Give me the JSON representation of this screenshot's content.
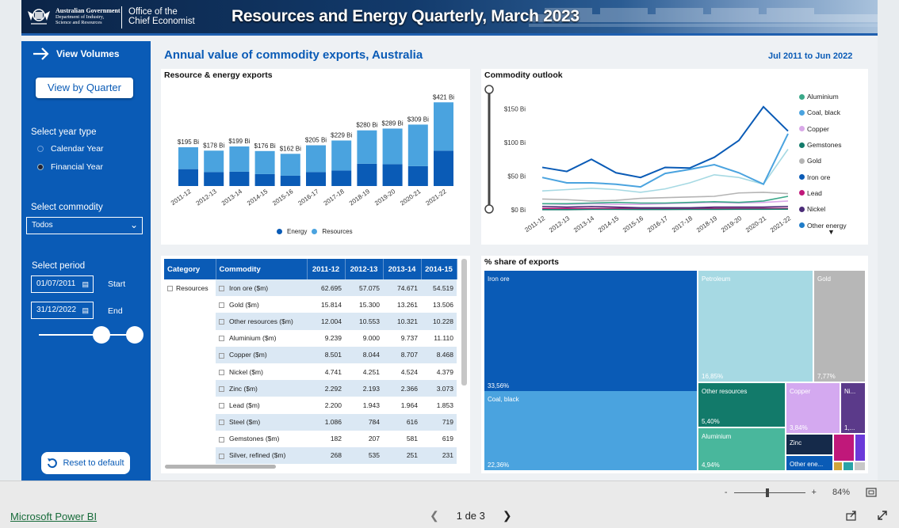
{
  "banner": {
    "gov_line1": "Australian Government",
    "gov_line2": "Department of Industry,",
    "gov_line3": "Science and Resources",
    "oce_line1": "Office of the",
    "oce_line2": "Chief Economist",
    "title": "Resources and Energy Quarterly, March 2023"
  },
  "sidebar": {
    "view_volumes": "View Volumes",
    "view_by_quarter": "View by Quarter",
    "year_type_label": "Select year type",
    "calendar_year": "Calendar Year",
    "financial_year": "Financial Year",
    "commodity_label": "Select commodity",
    "commodity_value": "Todos",
    "period_label": "Select period",
    "start_date": "01/07/2011",
    "start_label": "Start",
    "end_date": "31/12/2022",
    "end_label": "End",
    "reset": "Reset to default"
  },
  "main": {
    "title": "Annual value of commodity exports, Australia",
    "period": "Jul 2011 to Jun 2022"
  },
  "bar_chart": {
    "title": "Resource & energy exports",
    "legend": [
      "Energy",
      "Resources"
    ],
    "colors": {
      "energy": "#0a5bb6",
      "resources": "#4aa3df"
    }
  },
  "line_chart": {
    "title": "Commodity outlook",
    "y_ticks": [
      "$150 Bi",
      "$100 Bi",
      "$50 Bi",
      "$0 Bi"
    ],
    "legend": [
      {
        "name": "Aluminium",
        "color": "#3aa889"
      },
      {
        "name": "Coal, black",
        "color": "#4aa3df"
      },
      {
        "name": "Copper",
        "color": "#d9a9e8"
      },
      {
        "name": "Gemstones",
        "color": "#127a6a"
      },
      {
        "name": "Gold",
        "color": "#b4b4b4"
      },
      {
        "name": "Iron ore",
        "color": "#0a5bb6"
      },
      {
        "name": "Lead",
        "color": "#c0187a"
      },
      {
        "name": "Nickel",
        "color": "#4b2c78"
      },
      {
        "name": "Other energy",
        "color": "#1f7cc8"
      }
    ]
  },
  "chart_data": [
    {
      "type": "bar",
      "title": "Resource & energy exports",
      "categories": [
        "2011-12",
        "2012-13",
        "2013-14",
        "2014-15",
        "2015-16",
        "2016-17",
        "2017-18",
        "2018-19",
        "2019-20",
        "2020-21",
        "2021-22"
      ],
      "totals_labels": [
        "$195 Bi",
        "$178 Bi",
        "$199 Bi",
        "$176 Bi",
        "$162 Bi",
        "$205 Bi",
        "$229 Bi",
        "$280 Bi",
        "$289 Bi",
        "$309 Bi",
        "$421 Bi"
      ],
      "series": [
        {
          "name": "Energy",
          "values": [
            85,
            70,
            72,
            60,
            52,
            70,
            78,
            112,
            110,
            100,
            178
          ]
        },
        {
          "name": "Resources",
          "values": [
            110,
            108,
            127,
            116,
            110,
            135,
            151,
            168,
            179,
            209,
            243
          ]
        }
      ],
      "ylim": [
        0,
        430
      ]
    },
    {
      "type": "line",
      "title": "Commodity outlook",
      "categories": [
        "2011-12",
        "2012-13",
        "2013-14",
        "2014-15",
        "2015-16",
        "2016-17",
        "2017-18",
        "2018-19",
        "2019-20",
        "2020-21",
        "2021-22"
      ],
      "ylim": [
        0,
        160
      ],
      "series": [
        {
          "name": "Iron ore",
          "values": [
            63,
            57,
            75,
            55,
            48,
            63,
            62,
            78,
            103,
            153,
            117
          ]
        },
        {
          "name": "Coal, black",
          "values": [
            48,
            40,
            40,
            38,
            34,
            54,
            60,
            67,
            55,
            38,
            113
          ]
        },
        {
          "name": "Other energy",
          "values": [
            28,
            30,
            32,
            30,
            26,
            31,
            40,
            52,
            48,
            38,
            90
          ]
        },
        {
          "name": "Gold",
          "values": [
            16,
            15,
            13,
            14,
            17,
            18,
            19,
            20,
            25,
            26,
            24
          ]
        },
        {
          "name": "Aluminium",
          "values": [
            9,
            9,
            10,
            11,
            10,
            10,
            11,
            12,
            11,
            13,
            20
          ]
        },
        {
          "name": "Copper",
          "values": [
            9,
            8,
            9,
            8,
            8,
            9,
            10,
            11,
            10,
            11,
            13
          ]
        },
        {
          "name": "Nickel",
          "values": [
            5,
            4,
            5,
            4,
            3,
            3,
            3,
            4,
            4,
            4,
            5
          ]
        },
        {
          "name": "Gemstones",
          "values": [
            0.2,
            0.2,
            0.6,
            0.6,
            0.5,
            0.5,
            0.6,
            0.7,
            0.8,
            0.8,
            0.9
          ]
        },
        {
          "name": "Lead",
          "values": [
            2,
            2,
            2,
            2,
            2,
            2,
            2,
            2,
            2,
            2,
            2
          ]
        }
      ]
    },
    {
      "type": "table",
      "columns": [
        "Category",
        "Commodity",
        "2011-12",
        "2012-13",
        "2013-14",
        "2014-15"
      ],
      "category": "Resources",
      "rows": [
        {
          "commodity": "Iron ore ($m)",
          "values": [
            "62.695",
            "57.075",
            "74.671",
            "54.519"
          ]
        },
        {
          "commodity": "Gold ($m)",
          "values": [
            "15.814",
            "15.300",
            "13.261",
            "13.506"
          ]
        },
        {
          "commodity": "Other resources ($m)",
          "values": [
            "12.004",
            "10.553",
            "10.321",
            "10.228"
          ]
        },
        {
          "commodity": "Aluminium ($m)",
          "values": [
            "9.239",
            "9.000",
            "9.737",
            "11.110"
          ]
        },
        {
          "commodity": "Copper ($m)",
          "values": [
            "8.501",
            "8.044",
            "8.707",
            "8.468"
          ]
        },
        {
          "commodity": "Nickel ($m)",
          "values": [
            "4.741",
            "4.251",
            "4.524",
            "4.379"
          ]
        },
        {
          "commodity": "Zinc ($m)",
          "values": [
            "2.292",
            "2.193",
            "2.366",
            "3.073"
          ]
        },
        {
          "commodity": "Lead ($m)",
          "values": [
            "2.200",
            "1.943",
            "1.964",
            "1.853"
          ]
        },
        {
          "commodity": "Steel ($m)",
          "values": [
            "1.086",
            "784",
            "616",
            "719"
          ]
        },
        {
          "commodity": "Gemstones ($m)",
          "values": [
            "182",
            "207",
            "581",
            "619"
          ]
        },
        {
          "commodity": "Silver, refined ($m)",
          "values": [
            "268",
            "535",
            "251",
            "231"
          ]
        }
      ]
    },
    {
      "type": "treemap",
      "title": "% share of exports",
      "items": [
        {
          "name": "Iron ore",
          "value": "33,56%",
          "color": "#0a5bb6"
        },
        {
          "name": "Coal, black",
          "value": "22,36%",
          "color": "#4aa3df"
        },
        {
          "name": "Petroleum",
          "value": "16,85%",
          "color": "#a6d9e3"
        },
        {
          "name": "Gold",
          "value": "7,77%",
          "color": "#b7b7b7"
        },
        {
          "name": "Other resources",
          "value": "5,40%",
          "color": "#127a6a"
        },
        {
          "name": "Aluminium",
          "value": "4,94%",
          "color": "#49b79c"
        },
        {
          "name": "Copper",
          "value": "3,84%",
          "color": "#d4a9f0"
        },
        {
          "name": "Ni...",
          "value": "1,...",
          "color": "#5b3a8a"
        },
        {
          "name": "Zinc",
          "value": "",
          "color": "#152a4a"
        },
        {
          "name": "Other ene...",
          "value": "",
          "color": "#0a5bb6"
        }
      ]
    }
  ],
  "table": {
    "headers": [
      "Category",
      "Commodity",
      "2011-12",
      "2012-13",
      "2013-14",
      "2014-15"
    ]
  },
  "treemap": {
    "title": "% share of exports"
  },
  "footer": {
    "zoom_minus": "-",
    "zoom_plus": "+",
    "zoom_level": "84%",
    "link": "Microsoft Power BI",
    "page": "1 de 3"
  }
}
